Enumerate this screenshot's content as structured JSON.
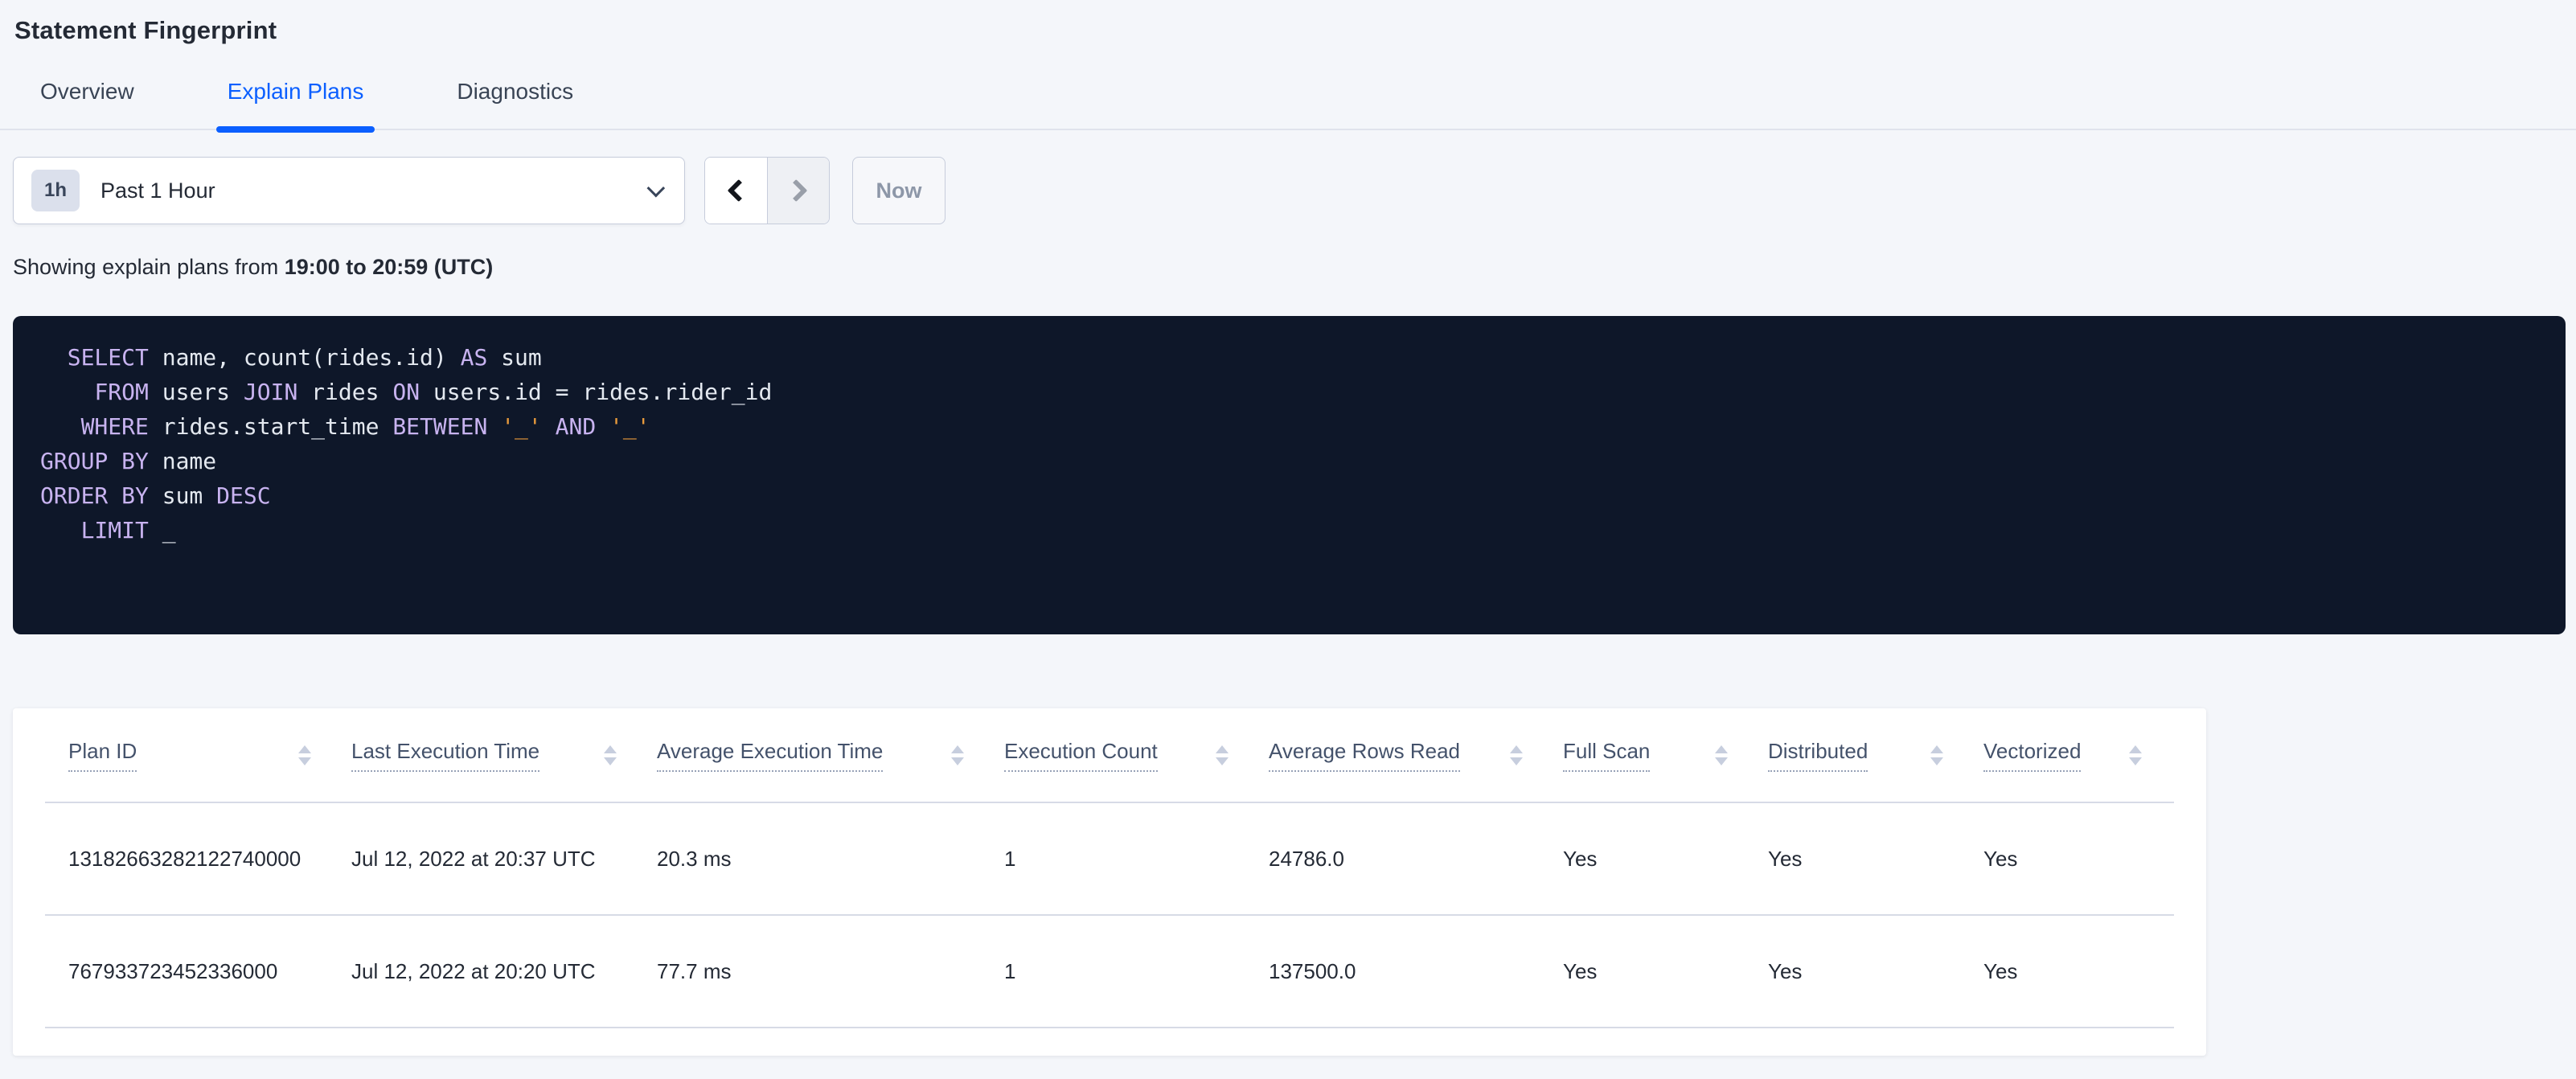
{
  "page": {
    "title": "Statement Fingerprint"
  },
  "tabs": [
    {
      "label": "Overview",
      "active": false
    },
    {
      "label": "Explain Plans",
      "active": true
    },
    {
      "label": "Diagnostics",
      "active": false
    }
  ],
  "time_picker": {
    "badge": "1h",
    "selected": "Past 1 Hour",
    "now_label": "Now"
  },
  "timeframe_note": {
    "prefix": "Showing explain plans from ",
    "bold": "19:00 to 20:59 (UTC)"
  },
  "sql": {
    "lines": [
      [
        {
          "t": "  "
        },
        {
          "t": "SELECT",
          "k": "kw"
        },
        {
          "t": " name, count(rides.id) "
        },
        {
          "t": "AS",
          "k": "kw"
        },
        {
          "t": " sum"
        }
      ],
      [
        {
          "t": "    "
        },
        {
          "t": "FROM",
          "k": "kw"
        },
        {
          "t": " users "
        },
        {
          "t": "JOIN",
          "k": "kw"
        },
        {
          "t": " rides "
        },
        {
          "t": "ON",
          "k": "kw"
        },
        {
          "t": " users.id = rides.rider_id"
        }
      ],
      [
        {
          "t": "   "
        },
        {
          "t": "WHERE",
          "k": "kw"
        },
        {
          "t": " rides.start_time "
        },
        {
          "t": "BETWEEN",
          "k": "kw"
        },
        {
          "t": " "
        },
        {
          "t": "'_'",
          "k": "lit"
        },
        {
          "t": " "
        },
        {
          "t": "AND",
          "k": "kw"
        },
        {
          "t": " "
        },
        {
          "t": "'_'",
          "k": "lit"
        }
      ],
      [
        {
          "t": "GROUP BY",
          "k": "kw"
        },
        {
          "t": " name"
        }
      ],
      [
        {
          "t": "ORDER BY",
          "k": "kw"
        },
        {
          "t": " sum "
        },
        {
          "t": "DESC",
          "k": "kw"
        }
      ],
      [
        {
          "t": "   "
        },
        {
          "t": "LIMIT",
          "k": "kw"
        },
        {
          "t": " _"
        }
      ]
    ]
  },
  "table": {
    "columns": [
      "Plan ID",
      "Last Execution Time",
      "Average Execution Time",
      "Execution Count",
      "Average Rows Read",
      "Full Scan",
      "Distributed",
      "Vectorized"
    ],
    "rows": [
      [
        "13182663282122740000",
        "Jul 12, 2022 at 20:37 UTC",
        "20.3 ms",
        "1",
        "24786.0",
        "Yes",
        "Yes",
        "Yes"
      ],
      [
        "767933723452336000",
        "Jul 12, 2022 at 20:20 UTC",
        "77.7 ms",
        "1",
        "137500.0",
        "Yes",
        "Yes",
        "Yes"
      ]
    ]
  },
  "colors": {
    "accent_blue": "#0b5fff",
    "page_background": "#f4f6fa",
    "code_background": "#0e1729",
    "code_keyword": "#c8b3f0",
    "code_literal": "#e79a3c",
    "code_plain": "#e4e9f0"
  }
}
